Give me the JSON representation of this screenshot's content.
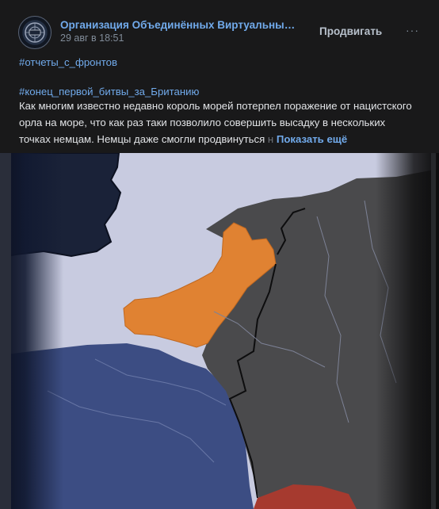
{
  "group": {
    "name": "Организация Объединённых Виртуальных Госу...",
    "date": "29 авг в 18:51"
  },
  "actions": {
    "promote": "Продвигать",
    "more": "···"
  },
  "post": {
    "tag1": "#отчеты_с_фронтов",
    "tag2": "#конец_первой_битвы_за_Британию",
    "line1": "Как многим известно недавно король морей потерпел поражение от нацистского",
    "line2": "орла на море, что как раз таки позволило совершить высадку в нескольких",
    "line3": "точках немцам. Немцы даже смогли продвинуться",
    "line3_fade": " н",
    "show_more": "Показать ещё"
  },
  "colors": {
    "sea": "#c8cbe0",
    "britain": "#1a2238",
    "occupied": "#e08232",
    "germany": "#4a4a4c",
    "france": "#3c4d83",
    "switzerland": "#a63a2f"
  },
  "icons": {
    "avatar": "un-emblem-icon",
    "more": "more-horizontal-icon"
  }
}
